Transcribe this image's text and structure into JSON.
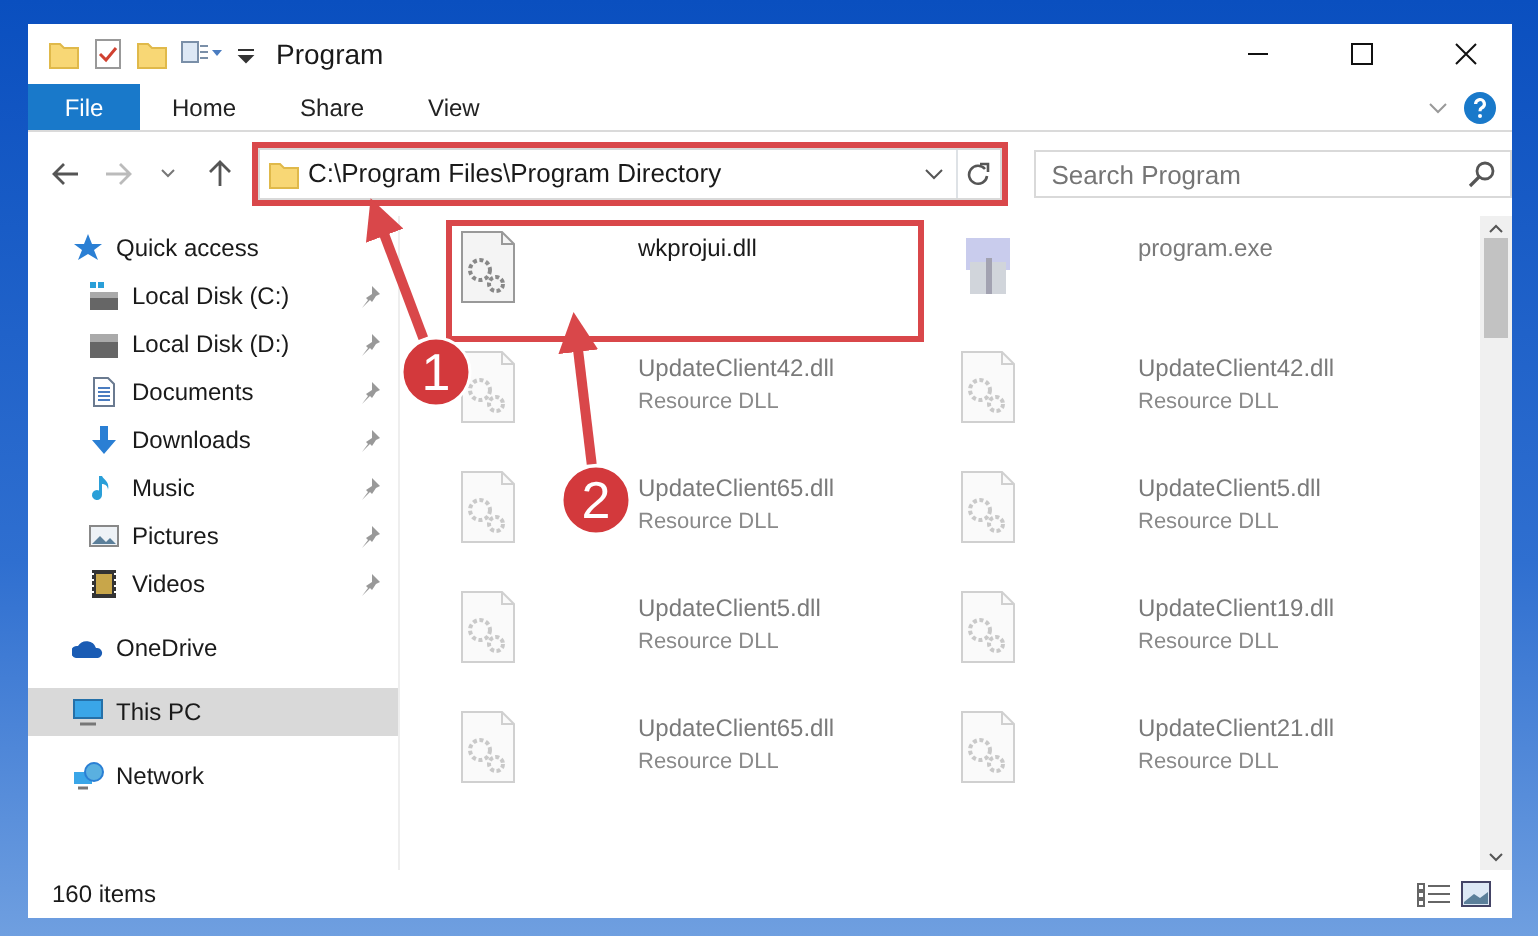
{
  "window": {
    "title": "Program"
  },
  "ribbon_tabs": [
    {
      "label": "File",
      "selected": true
    },
    {
      "label": "Home",
      "selected": false
    },
    {
      "label": "Share",
      "selected": false
    },
    {
      "label": "View",
      "selected": false
    }
  ],
  "address_bar": {
    "path": "C:\\Program Files\\Program Directory",
    "highlighted": true
  },
  "search": {
    "placeholder": "Search Program"
  },
  "sidebar": {
    "items": [
      {
        "label": "Quick access",
        "kind": "star",
        "selected": false,
        "children": [
          {
            "label": "Local Disk (C:)",
            "kind": "system-disk",
            "selected": false,
            "pinned": true
          },
          {
            "label": "Local Disk (D:)",
            "kind": "disk",
            "selected": false,
            "pinned": true
          },
          {
            "label": "Documents",
            "kind": "documents",
            "selected": false,
            "pinned": true
          },
          {
            "label": "Downloads",
            "kind": "downloads",
            "selected": false,
            "pinned": true
          },
          {
            "label": "Music",
            "kind": "music",
            "selected": false,
            "pinned": true
          },
          {
            "label": "Pictures",
            "kind": "pictures",
            "selected": false,
            "pinned": true
          },
          {
            "label": "Videos",
            "kind": "videos",
            "selected": false,
            "pinned": true
          }
        ]
      },
      {
        "label": "OneDrive",
        "kind": "cloud",
        "selected": false
      },
      {
        "label": "This PC",
        "kind": "computer",
        "selected": true
      },
      {
        "label": "Network",
        "kind": "network",
        "selected": false
      }
    ]
  },
  "files": [
    {
      "name": "wkprojui.dll",
      "kind": "dll",
      "dimmed": false,
      "highlighted": true
    },
    {
      "name": "program.exe",
      "kind": "exe",
      "dimmed": true,
      "highlighted": false
    },
    {
      "name": "UpdateClient42.dll",
      "type": "Resource DLL",
      "kind": "dll",
      "dimmed": true,
      "highlighted": false
    },
    {
      "name": "UpdateClient42.dll",
      "type": "Resource DLL",
      "kind": "dll",
      "dimmed": true,
      "highlighted": false
    },
    {
      "name": "UpdateClient65.dll",
      "type": "Resource DLL",
      "kind": "dll",
      "dimmed": true,
      "highlighted": false
    },
    {
      "name": "UpdateClient5.dll",
      "type": "Resource DLL",
      "kind": "dll",
      "dimmed": true,
      "highlighted": false
    },
    {
      "name": "UpdateClient5.dll",
      "type": "Resource DLL",
      "kind": "dll",
      "dimmed": true,
      "highlighted": false
    },
    {
      "name": "UpdateClient19.dll",
      "type": "Resource DLL",
      "kind": "dll",
      "dimmed": true,
      "highlighted": false
    },
    {
      "name": "UpdateClient65.dll",
      "type": "Resource DLL",
      "kind": "dll",
      "dimmed": true,
      "highlighted": false
    },
    {
      "name": "UpdateClient21.dll",
      "type": "Resource DLL",
      "kind": "dll",
      "dimmed": true,
      "highlighted": false
    }
  ],
  "status_bar": {
    "item_count": "160 items"
  },
  "annotations": [
    {
      "label": "1"
    },
    {
      "label": "2"
    }
  ]
}
